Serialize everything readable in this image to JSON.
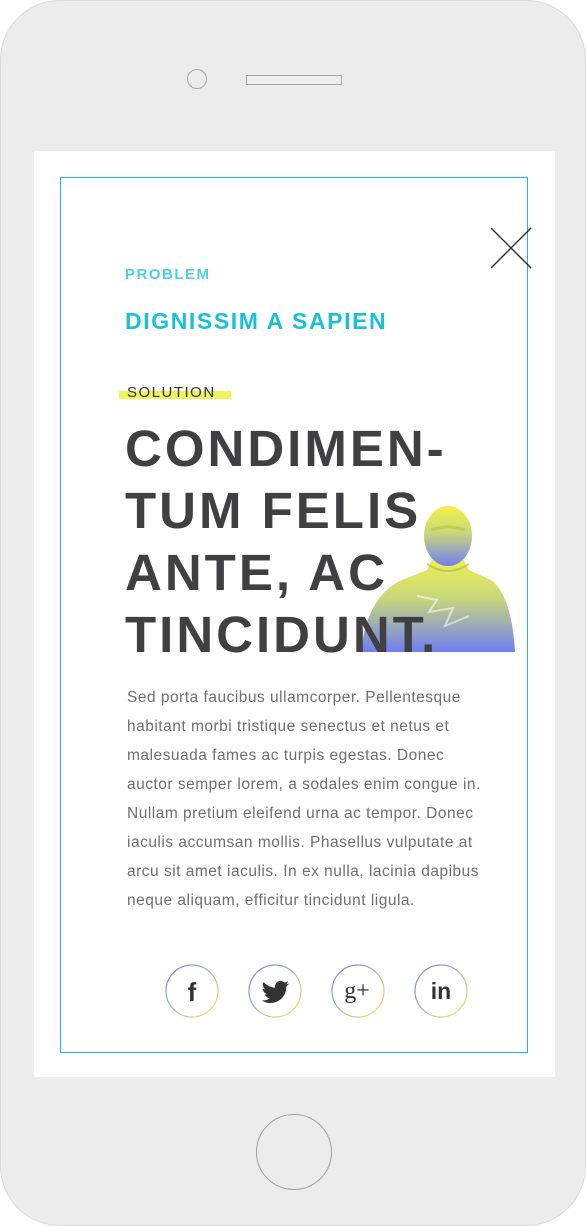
{
  "modal": {
    "problem_label": "PROBLEM",
    "problem_title": "DIGNISSIM A SAPIEN",
    "solution_label": "SOLUTION",
    "headline_lines": [
      "CONDIMEN-",
      "TUM FELIS",
      "ANTE, AC",
      "TINCIDUNT."
    ],
    "body_lines": [
      "Sed porta faucibus ullamcorper. Pellentesque",
      "habitant morbi tristique senectus et netus et",
      "malesuada fames ac turpis egestas. Donec",
      "auctor semper lorem, a sodales enim congue in.",
      "Nullam pretium eleifend urna ac tempor. Donec",
      "iaculis accumsan mollis. Phasellus vulputate at",
      "arcu sit amet iaculis. In ex nulla, lacinia dapibus",
      "neque aliquam, efficitur tincidunt ligula."
    ]
  },
  "social": {
    "facebook_glyph": "f",
    "google_plus_glyph": "g+",
    "linkedin_glyph": "in"
  },
  "icons": [
    "close-icon",
    "facebook-icon",
    "twitter-icon",
    "google-plus-icon",
    "linkedin-icon"
  ],
  "colors": {
    "accent": "#19c1d6",
    "frame_border": "#22b8c4",
    "highlight": "#eef55a",
    "headline": "#404042",
    "body": "#6f6f6f",
    "device": "#ececec"
  }
}
